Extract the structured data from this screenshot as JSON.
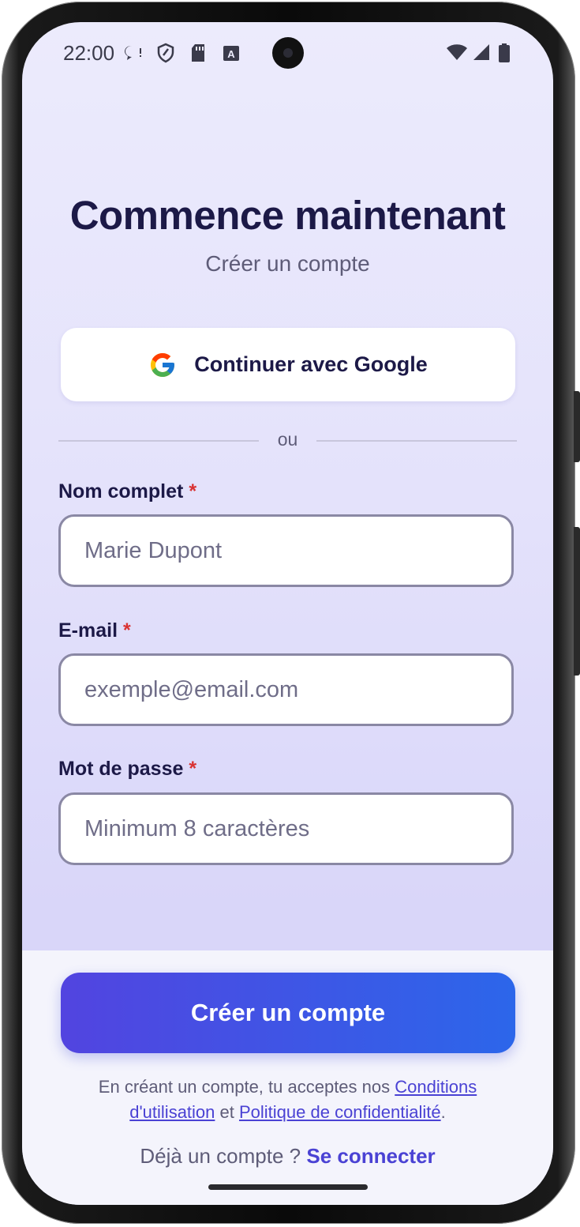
{
  "status_bar": {
    "time": "22:00",
    "icons": [
      "chat-bubble-icon",
      "shield-icon",
      "sd-card-icon",
      "text-a-icon"
    ],
    "right_icons": [
      "wifi-icon",
      "signal-icon",
      "battery-icon"
    ]
  },
  "header": {
    "title": "Commence maintenant",
    "subtitle": "Créer un compte"
  },
  "google_button": {
    "label": "Continuer avec Google",
    "icon": "google-logo-icon"
  },
  "divider": {
    "text": "ou"
  },
  "form": {
    "name": {
      "label": "Nom complet",
      "required_mark": "*",
      "placeholder": "Marie Dupont",
      "value": ""
    },
    "email": {
      "label": "E-mail",
      "required_mark": "*",
      "placeholder": "exemple@email.com",
      "value": ""
    },
    "password": {
      "label": "Mot de passe",
      "required_mark": "*",
      "placeholder": "Minimum 8 caractères",
      "value": ""
    }
  },
  "footer": {
    "create_button": "Créer un compte",
    "terms_prefix": "En créant un compte, tu acceptes nos ",
    "terms_link": "Conditions d'utilisation",
    "terms_joiner": " et ",
    "privacy_link": "Politique de confidentialité",
    "terms_suffix": ".",
    "login_prompt": "Déjà un compte ? ",
    "login_link": "Se connecter"
  },
  "colors": {
    "accent_start": "#5244e0",
    "accent_end": "#2c66ea",
    "required": "#d93232",
    "title": "#1c1947",
    "link": "#4a42d4"
  }
}
